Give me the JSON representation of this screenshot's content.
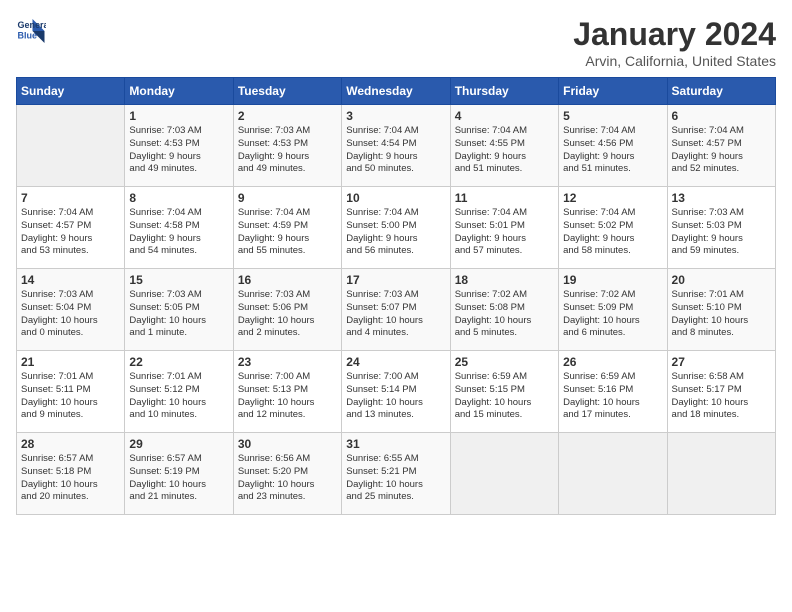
{
  "header": {
    "logo_line1": "General",
    "logo_line2": "Blue",
    "month": "January 2024",
    "location": "Arvin, California, United States"
  },
  "days_of_week": [
    "Sunday",
    "Monday",
    "Tuesday",
    "Wednesday",
    "Thursday",
    "Friday",
    "Saturday"
  ],
  "weeks": [
    [
      {
        "day": "",
        "info": ""
      },
      {
        "day": "1",
        "info": "Sunrise: 7:03 AM\nSunset: 4:53 PM\nDaylight: 9 hours\nand 49 minutes."
      },
      {
        "day": "2",
        "info": "Sunrise: 7:03 AM\nSunset: 4:53 PM\nDaylight: 9 hours\nand 49 minutes."
      },
      {
        "day": "3",
        "info": "Sunrise: 7:04 AM\nSunset: 4:54 PM\nDaylight: 9 hours\nand 50 minutes."
      },
      {
        "day": "4",
        "info": "Sunrise: 7:04 AM\nSunset: 4:55 PM\nDaylight: 9 hours\nand 51 minutes."
      },
      {
        "day": "5",
        "info": "Sunrise: 7:04 AM\nSunset: 4:56 PM\nDaylight: 9 hours\nand 51 minutes."
      },
      {
        "day": "6",
        "info": "Sunrise: 7:04 AM\nSunset: 4:57 PM\nDaylight: 9 hours\nand 52 minutes."
      }
    ],
    [
      {
        "day": "7",
        "info": "Sunrise: 7:04 AM\nSunset: 4:57 PM\nDaylight: 9 hours\nand 53 minutes."
      },
      {
        "day": "8",
        "info": "Sunrise: 7:04 AM\nSunset: 4:58 PM\nDaylight: 9 hours\nand 54 minutes."
      },
      {
        "day": "9",
        "info": "Sunrise: 7:04 AM\nSunset: 4:59 PM\nDaylight: 9 hours\nand 55 minutes."
      },
      {
        "day": "10",
        "info": "Sunrise: 7:04 AM\nSunset: 5:00 PM\nDaylight: 9 hours\nand 56 minutes."
      },
      {
        "day": "11",
        "info": "Sunrise: 7:04 AM\nSunset: 5:01 PM\nDaylight: 9 hours\nand 57 minutes."
      },
      {
        "day": "12",
        "info": "Sunrise: 7:04 AM\nSunset: 5:02 PM\nDaylight: 9 hours\nand 58 minutes."
      },
      {
        "day": "13",
        "info": "Sunrise: 7:03 AM\nSunset: 5:03 PM\nDaylight: 9 hours\nand 59 minutes."
      }
    ],
    [
      {
        "day": "14",
        "info": "Sunrise: 7:03 AM\nSunset: 5:04 PM\nDaylight: 10 hours\nand 0 minutes."
      },
      {
        "day": "15",
        "info": "Sunrise: 7:03 AM\nSunset: 5:05 PM\nDaylight: 10 hours\nand 1 minute."
      },
      {
        "day": "16",
        "info": "Sunrise: 7:03 AM\nSunset: 5:06 PM\nDaylight: 10 hours\nand 2 minutes."
      },
      {
        "day": "17",
        "info": "Sunrise: 7:03 AM\nSunset: 5:07 PM\nDaylight: 10 hours\nand 4 minutes."
      },
      {
        "day": "18",
        "info": "Sunrise: 7:02 AM\nSunset: 5:08 PM\nDaylight: 10 hours\nand 5 minutes."
      },
      {
        "day": "19",
        "info": "Sunrise: 7:02 AM\nSunset: 5:09 PM\nDaylight: 10 hours\nand 6 minutes."
      },
      {
        "day": "20",
        "info": "Sunrise: 7:01 AM\nSunset: 5:10 PM\nDaylight: 10 hours\nand 8 minutes."
      }
    ],
    [
      {
        "day": "21",
        "info": "Sunrise: 7:01 AM\nSunset: 5:11 PM\nDaylight: 10 hours\nand 9 minutes."
      },
      {
        "day": "22",
        "info": "Sunrise: 7:01 AM\nSunset: 5:12 PM\nDaylight: 10 hours\nand 10 minutes."
      },
      {
        "day": "23",
        "info": "Sunrise: 7:00 AM\nSunset: 5:13 PM\nDaylight: 10 hours\nand 12 minutes."
      },
      {
        "day": "24",
        "info": "Sunrise: 7:00 AM\nSunset: 5:14 PM\nDaylight: 10 hours\nand 13 minutes."
      },
      {
        "day": "25",
        "info": "Sunrise: 6:59 AM\nSunset: 5:15 PM\nDaylight: 10 hours\nand 15 minutes."
      },
      {
        "day": "26",
        "info": "Sunrise: 6:59 AM\nSunset: 5:16 PM\nDaylight: 10 hours\nand 17 minutes."
      },
      {
        "day": "27",
        "info": "Sunrise: 6:58 AM\nSunset: 5:17 PM\nDaylight: 10 hours\nand 18 minutes."
      }
    ],
    [
      {
        "day": "28",
        "info": "Sunrise: 6:57 AM\nSunset: 5:18 PM\nDaylight: 10 hours\nand 20 minutes."
      },
      {
        "day": "29",
        "info": "Sunrise: 6:57 AM\nSunset: 5:19 PM\nDaylight: 10 hours\nand 21 minutes."
      },
      {
        "day": "30",
        "info": "Sunrise: 6:56 AM\nSunset: 5:20 PM\nDaylight: 10 hours\nand 23 minutes."
      },
      {
        "day": "31",
        "info": "Sunrise: 6:55 AM\nSunset: 5:21 PM\nDaylight: 10 hours\nand 25 minutes."
      },
      {
        "day": "",
        "info": ""
      },
      {
        "day": "",
        "info": ""
      },
      {
        "day": "",
        "info": ""
      }
    ]
  ]
}
